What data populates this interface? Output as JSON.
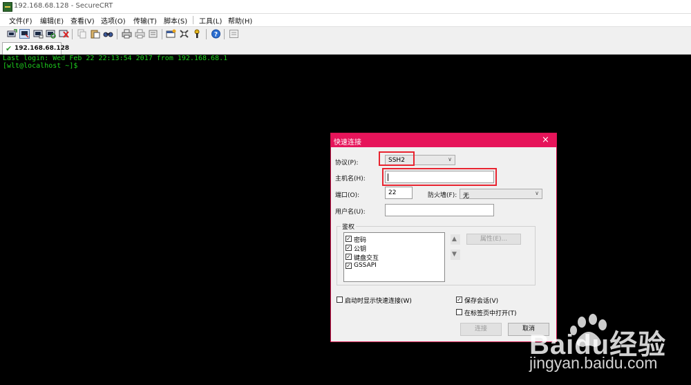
{
  "window": {
    "title": "192.168.68.128 - SecureCRT"
  },
  "menu": [
    "文件(F)",
    "编辑(E)",
    "查看(V)",
    "选项(O)",
    "传输(T)",
    "脚本(S)",
    "工具(L)",
    "帮助(H)"
  ],
  "tab": {
    "label": "192.168.68.128"
  },
  "terminal": {
    "lines": [
      "Last login: Wed Feb 22 22:13:54 2017 from 192.168.68.1",
      "[wlt@localhost ~]$"
    ]
  },
  "dialog": {
    "title": "快速连接",
    "close": "×",
    "protocol_label": "协议(P):",
    "protocol_value": "SSH2",
    "hostname_label": "主机名(H):",
    "hostname_value": "",
    "port_label": "端口(O):",
    "port_value": "22",
    "firewall_label": "防火墙(F):",
    "firewall_value": "无",
    "username_label": "用户名(U):",
    "username_value": "",
    "auth_group": "鉴权",
    "auth_methods": [
      {
        "label": "密码",
        "checked": true
      },
      {
        "label": "公钥",
        "checked": true
      },
      {
        "label": "键盘交互",
        "checked": true
      },
      {
        "label": "GSSAPI",
        "checked": true
      }
    ],
    "properties_button": "属性(E)...",
    "show_on_startup": {
      "label": "启动时显示快速连接(W)",
      "checked": false
    },
    "save_session": {
      "label": "保存会话(V)",
      "checked": true
    },
    "open_in_tab": {
      "label": "在标签页中打开(T)",
      "checked": false
    },
    "connect_button": "连接",
    "cancel_button": "取消"
  },
  "watermark": {
    "brand": "Baidu经验",
    "url": "jingyan.baidu.com"
  },
  "colors": {
    "terminal_text": "#1ed41e",
    "dialog_accent": "#e6145a",
    "highlight_box": "#e8232f"
  }
}
